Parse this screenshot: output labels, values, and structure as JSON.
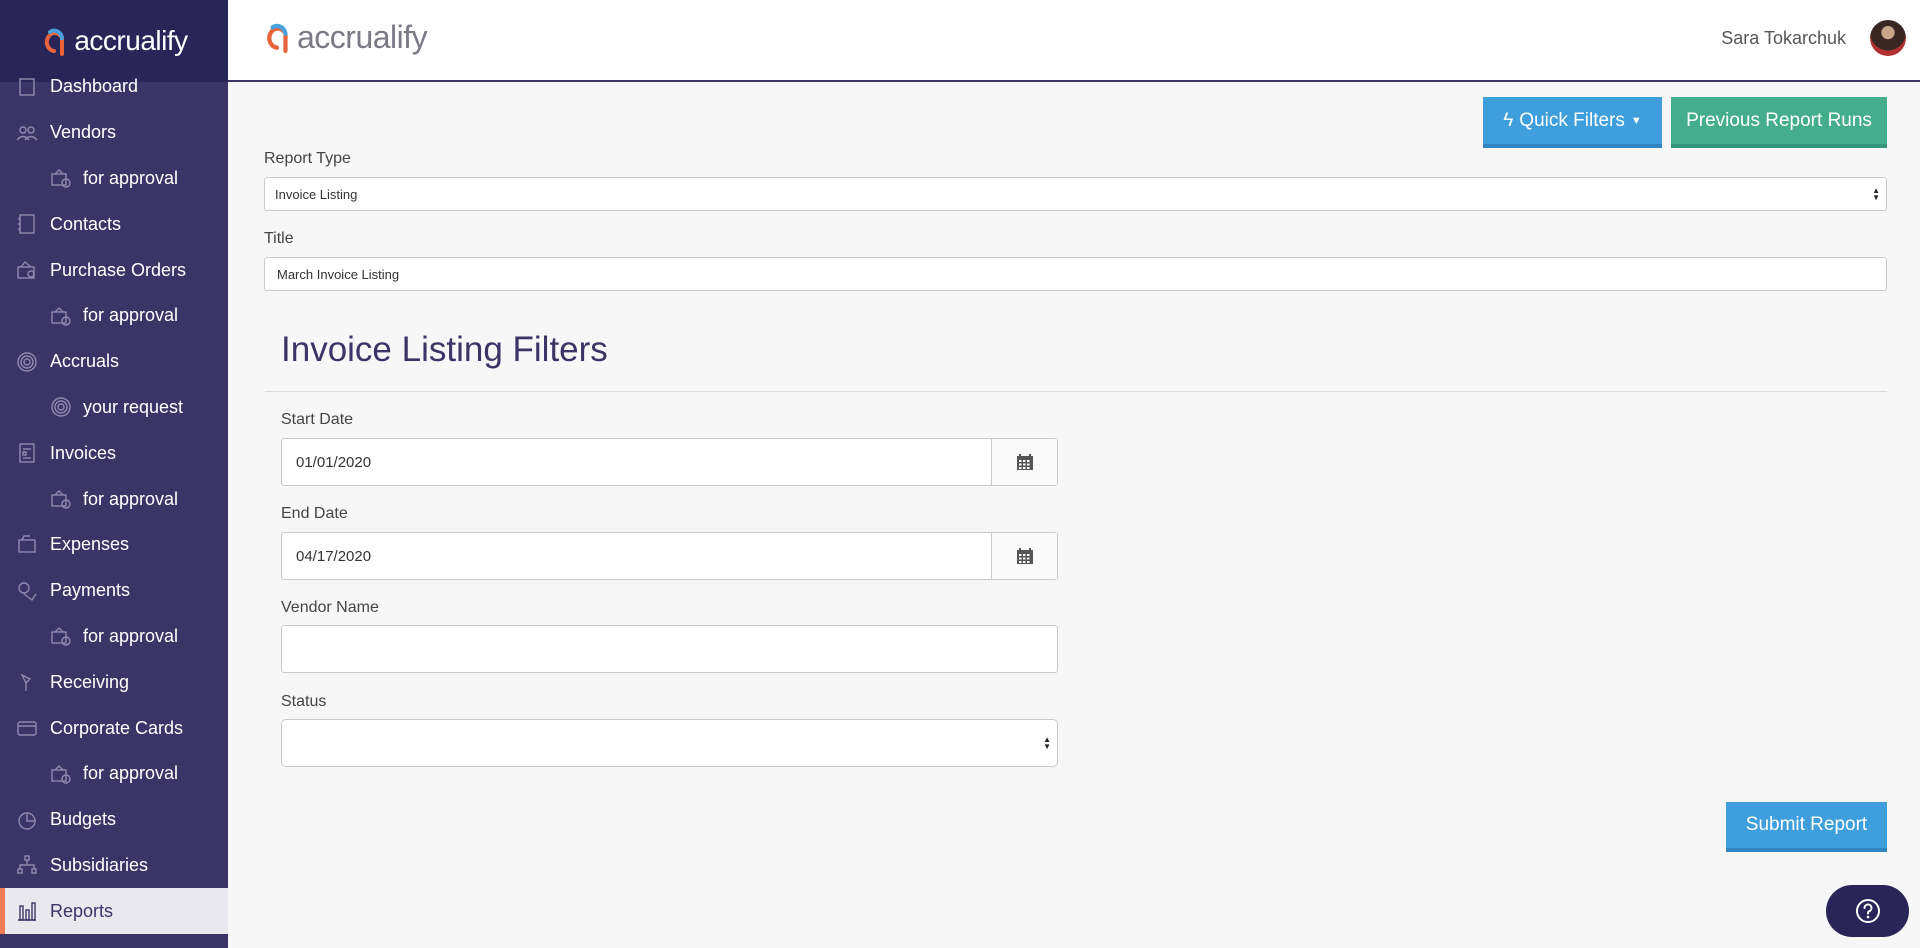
{
  "app": {
    "brand": "accrualify"
  },
  "user": {
    "name": "Sara Tokarchuk"
  },
  "sidebar": {
    "items": [
      {
        "label": "Dashboard",
        "icon": "dashboard-icon",
        "sub": false,
        "active": false
      },
      {
        "label": "Vendors",
        "icon": "vendors-icon",
        "sub": false,
        "active": false
      },
      {
        "label": "for approval",
        "icon": "vendor-approval-icon",
        "sub": true,
        "active": false
      },
      {
        "label": "Contacts",
        "icon": "contacts-icon",
        "sub": false,
        "active": false
      },
      {
        "label": "Purchase Orders",
        "icon": "purchase-orders-icon",
        "sub": false,
        "active": false
      },
      {
        "label": "for approval",
        "icon": "po-approval-icon",
        "sub": true,
        "active": false
      },
      {
        "label": "Accruals",
        "icon": "accruals-icon",
        "sub": false,
        "active": false
      },
      {
        "label": "your request",
        "icon": "accrual-request-icon",
        "sub": true,
        "active": false
      },
      {
        "label": "Invoices",
        "icon": "invoices-icon",
        "sub": false,
        "active": false
      },
      {
        "label": "for approval",
        "icon": "invoice-approval-icon",
        "sub": true,
        "active": false
      },
      {
        "label": "Expenses",
        "icon": "expenses-icon",
        "sub": false,
        "active": false
      },
      {
        "label": "Payments",
        "icon": "payments-icon",
        "sub": false,
        "active": false
      },
      {
        "label": "for approval",
        "icon": "payment-approval-icon",
        "sub": true,
        "active": false
      },
      {
        "label": "Receiving",
        "icon": "receiving-icon",
        "sub": false,
        "active": false
      },
      {
        "label": "Corporate Cards",
        "icon": "corporate-cards-icon",
        "sub": false,
        "active": false
      },
      {
        "label": "for approval",
        "icon": "card-approval-icon",
        "sub": true,
        "active": false
      },
      {
        "label": "Budgets",
        "icon": "budgets-icon",
        "sub": false,
        "active": false
      },
      {
        "label": "Subsidiaries",
        "icon": "subsidiaries-icon",
        "sub": false,
        "active": false
      },
      {
        "label": "Reports",
        "icon": "reports-icon",
        "sub": false,
        "active": true
      }
    ]
  },
  "toolbar": {
    "quick_filters": "Quick Filters",
    "previous_runs": "Previous Report Runs"
  },
  "form": {
    "report_type_label": "Report Type",
    "report_type_value": "Invoice Listing",
    "title_label": "Title",
    "title_value": "March Invoice Listing",
    "section_title": "Invoice Listing Filters",
    "start_date_label": "Start Date",
    "start_date_value": "01/01/2020",
    "end_date_label": "End Date",
    "end_date_value": "04/17/2020",
    "vendor_name_label": "Vendor Name",
    "vendor_name_value": "",
    "status_label": "Status",
    "status_value": "",
    "submit": "Submit Report"
  },
  "colors": {
    "sidebar_bg": "#3b3466",
    "brand_bg": "#2a2558",
    "primary_blue": "#3f9fdc",
    "green": "#43ad8c",
    "active_accent": "#f07b52"
  }
}
